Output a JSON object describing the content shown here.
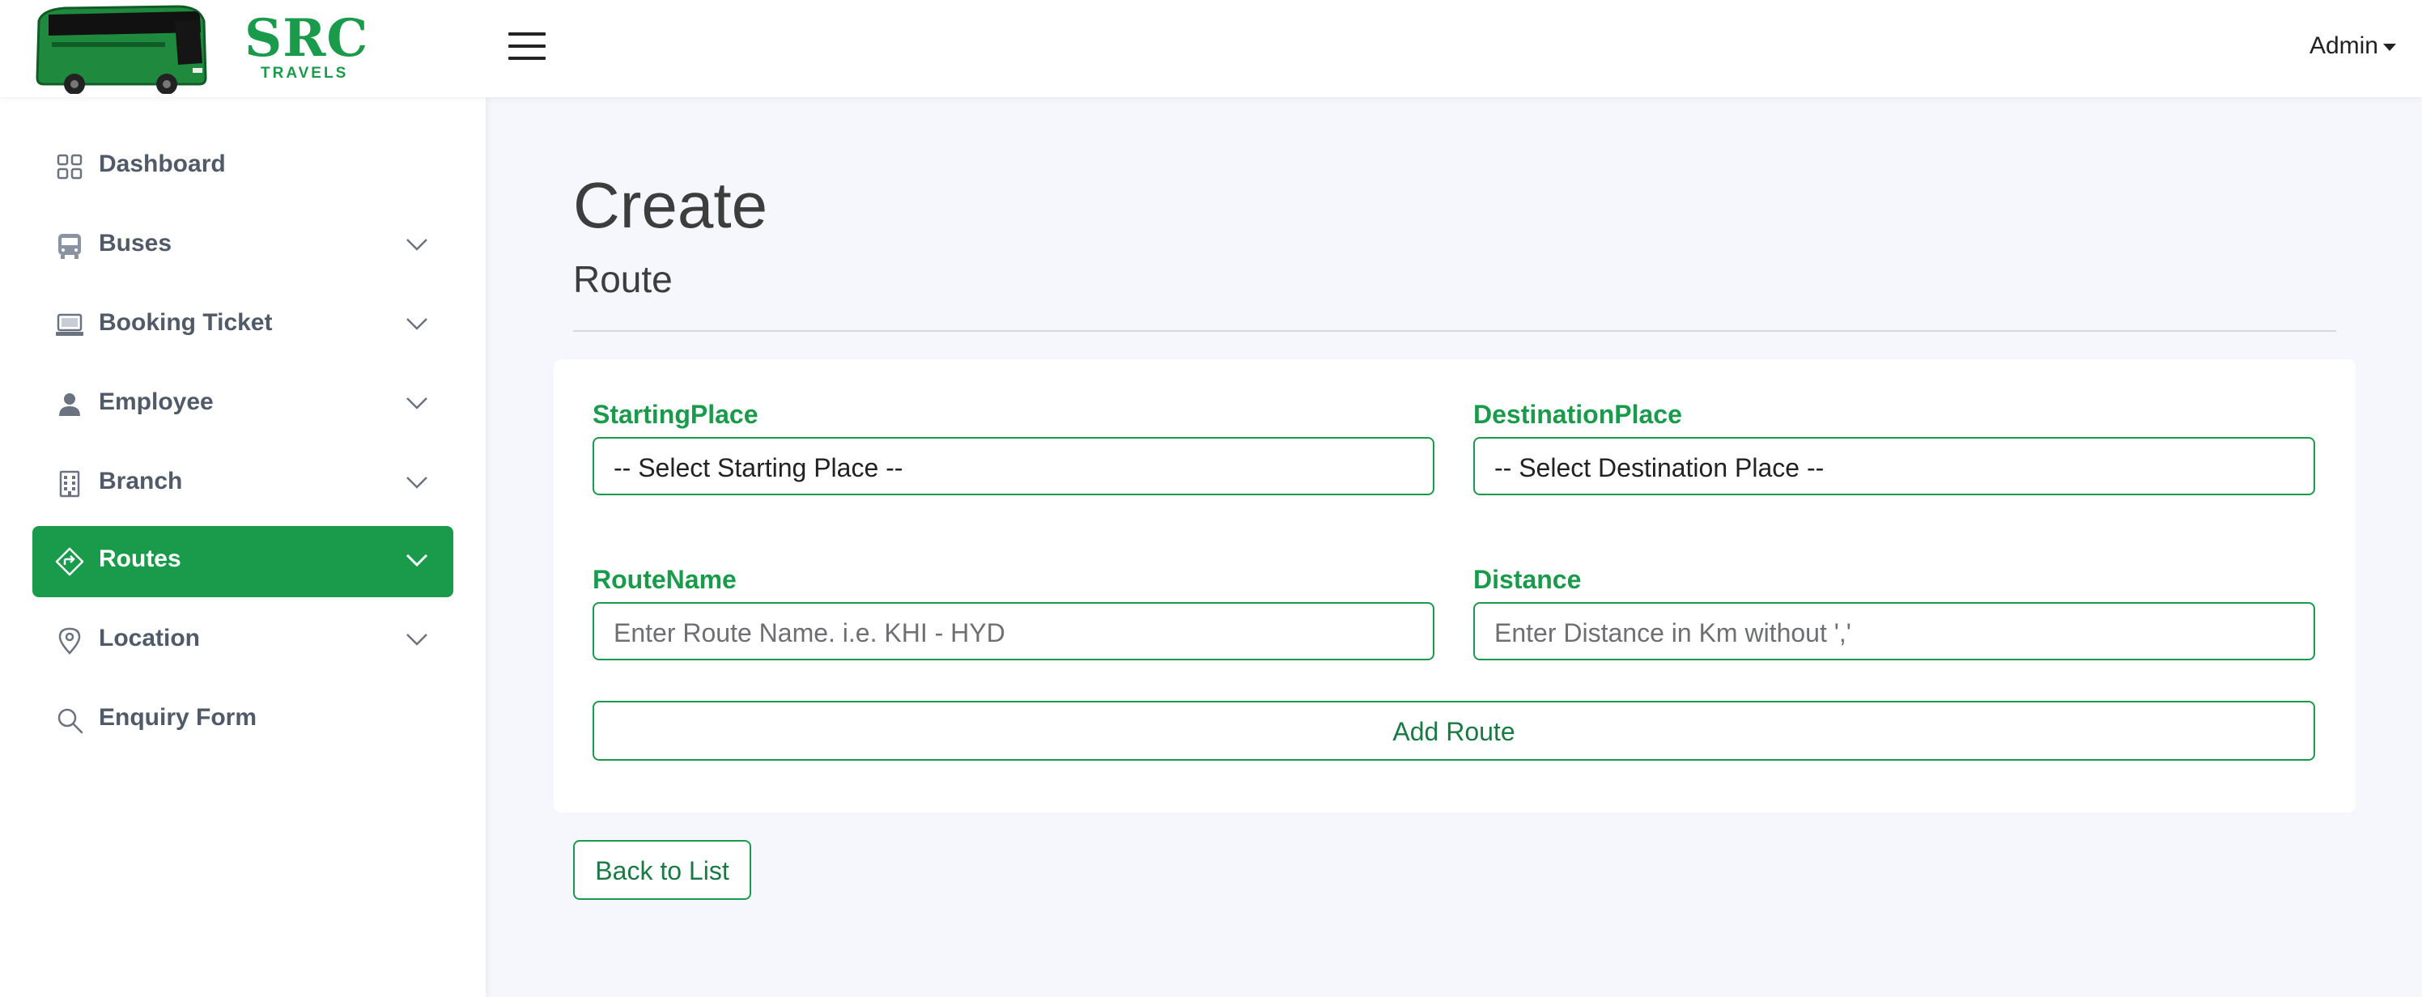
{
  "brand": {
    "name": "SRC",
    "tagline": "TRAVELS",
    "color": "#1a9b4b"
  },
  "header": {
    "menu_icon": "hamburger-icon",
    "user_menu_label": "Admin"
  },
  "sidebar": {
    "items": [
      {
        "label": "Dashboard",
        "icon": "grid-icon",
        "has_submenu": false,
        "active": false
      },
      {
        "label": "Buses",
        "icon": "bus-icon",
        "has_submenu": true,
        "active": false
      },
      {
        "label": "Booking Ticket",
        "icon": "laptop-icon",
        "has_submenu": true,
        "active": false
      },
      {
        "label": "Employee",
        "icon": "person-icon",
        "has_submenu": true,
        "active": false
      },
      {
        "label": "Branch",
        "icon": "building-icon",
        "has_submenu": true,
        "active": false
      },
      {
        "label": "Routes",
        "icon": "sign-icon",
        "has_submenu": true,
        "active": true
      },
      {
        "label": "Location",
        "icon": "map-pin-icon",
        "has_submenu": true,
        "active": false
      },
      {
        "label": "Enquiry Form",
        "icon": "search-icon",
        "has_submenu": false,
        "active": false
      }
    ]
  },
  "main": {
    "title": "Create",
    "subtitle": "Route",
    "form": {
      "starting_place": {
        "label": "StartingPlace",
        "value": "-- Select Starting Place --"
      },
      "destination_place": {
        "label": "DestinationPlace",
        "value": "-- Select Destination Place --"
      },
      "route_name": {
        "label": "RouteName",
        "placeholder": "Enter Route Name. i.e. KHI - HYD"
      },
      "distance": {
        "label": "Distance",
        "placeholder": "Enter Distance in Km without ','"
      },
      "submit_label": "Add Route"
    },
    "back_label": "Back to List"
  }
}
